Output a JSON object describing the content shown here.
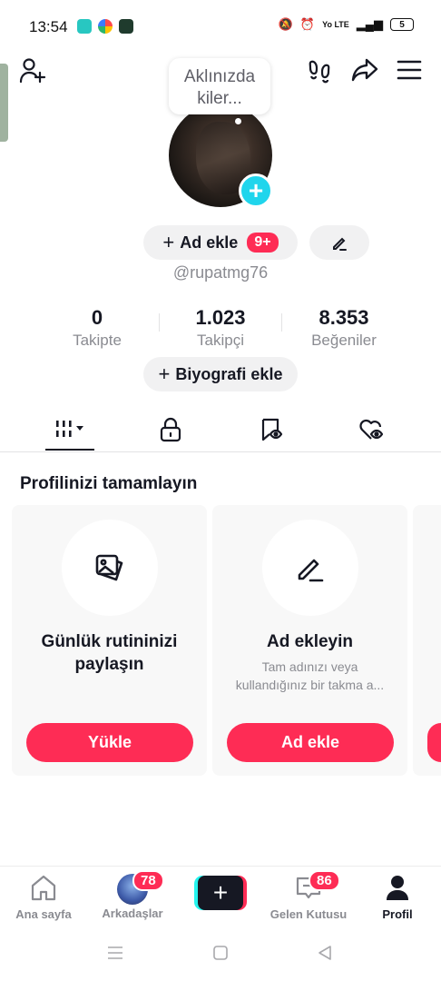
{
  "status_bar": {
    "time": "13:54",
    "signal_text": "Yo LTE",
    "battery": "5"
  },
  "top_bar": {
    "add_friend_icon": "person-plus-icon",
    "footprints_icon": "footprints-icon",
    "share_icon": "share-arrow-icon",
    "menu_icon": "hamburger-menu-icon"
  },
  "profile": {
    "bubble_line1": "Aklınızda",
    "bubble_line2": "kiler...",
    "add_name_label": "Ad ekle",
    "notif_badge": "9+",
    "username": "@rupatmg76",
    "bio_button": "Biyografi ekle"
  },
  "stats": [
    {
      "value": "0",
      "label": "Takipte"
    },
    {
      "value": "1.023",
      "label": "Takipçi"
    },
    {
      "value": "8.353",
      "label": "Beğeniler"
    }
  ],
  "tabs": [
    "videos-grid-icon",
    "lock-icon",
    "bookmark-hidden-icon",
    "heart-hidden-icon"
  ],
  "section": {
    "title": "Profilinizi tamamlayın"
  },
  "cards": [
    {
      "title": "Günlük rutininizi paylaşın",
      "subtitle": "",
      "button": "Yükle",
      "icon": "photos-icon"
    },
    {
      "title": "Ad ekleyin",
      "subtitle": "Tam adınızı veya kullandığınız bir takma a...",
      "button": "Ad ekle",
      "icon": "pen-icon"
    }
  ],
  "bottom_nav": {
    "home": "Ana sayfa",
    "friends": "Arkadaşlar",
    "friends_badge": "78",
    "inbox": "Gelen Kutusu",
    "inbox_badge": "86",
    "profile": "Profil"
  },
  "colors": {
    "accent": "#fe2c55",
    "cyan": "#20d5ec",
    "text": "#161823",
    "muted": "#8a8b91"
  }
}
